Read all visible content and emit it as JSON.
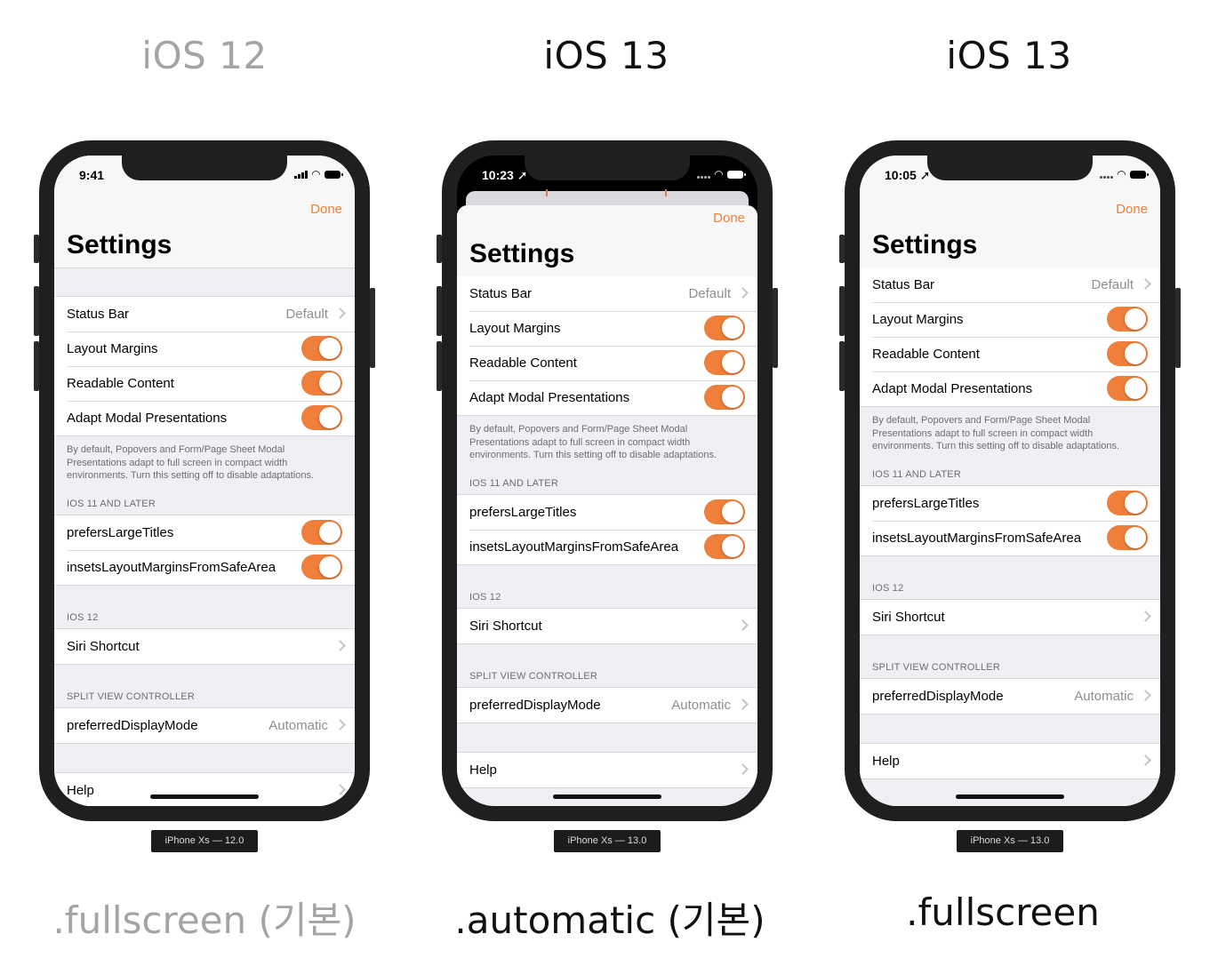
{
  "columns": [
    {
      "heading": "iOS 12",
      "caption": ".fullscreen (기본)",
      "device": "iPhone Xs — 12.0",
      "time": "9:41"
    },
    {
      "heading": "iOS 13",
      "caption": ".automatic (기본)",
      "device": "iPhone Xs — 13.0",
      "time": "10:23 ➚"
    },
    {
      "heading": "iOS 13",
      "caption": ".fullscreen",
      "device": "iPhone Xs — 13.0",
      "time": "10:05 ➚"
    }
  ],
  "settings": {
    "done": "Done",
    "title": "Settings",
    "status_bar": "Status Bar",
    "status_bar_value": "Default",
    "layout_margins": "Layout Margins",
    "readable_content": "Readable Content",
    "adapt_modal": "Adapt Modal Presentations",
    "adapt_footer": "By default, Popovers and Form/Page Sheet Modal Presentations adapt to full screen in compact width environments. Turn this setting off to disable adaptations.",
    "ios11_header": "IOS 11 AND LATER",
    "prefers_large_titles": "prefersLargeTitles",
    "insets_layout": "insetsLayoutMarginsFromSafeArea",
    "ios12_header": "IOS 12",
    "siri_shortcut": "Siri Shortcut",
    "split_header": "SPLIT VIEW CONTROLLER",
    "preferred_display_mode": "preferredDisplayMode",
    "preferred_display_mode_value": "Automatic",
    "help": "Help"
  },
  "colors": {
    "accent": "#ef7f3a",
    "grouped_background": "#efeff4",
    "secondary_text": "#6d6d72"
  }
}
